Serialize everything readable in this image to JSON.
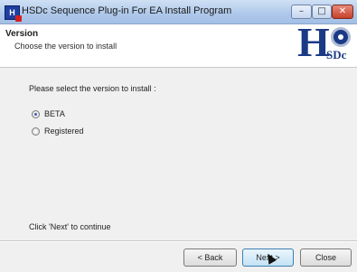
{
  "window": {
    "title": "HSDc Sequence Plug-in For EA Install Program",
    "app_icon_text": "H",
    "controls": {
      "minimize": "–",
      "maximize": "□",
      "close": "✕"
    }
  },
  "header": {
    "title": "Version",
    "subtitle": "Choose the version to install",
    "logo": {
      "letter": "H",
      "text": "SDc"
    }
  },
  "body": {
    "prompt": "Please select the version to install :",
    "options": [
      {
        "label": "BETA",
        "checked": true
      },
      {
        "label": "Registered",
        "checked": false
      }
    ],
    "footer_note": "Click 'Next' to continue"
  },
  "buttons": {
    "back": "< Back",
    "next": "Next >",
    "close": "Close"
  },
  "colors": {
    "brand": "#1b3a86",
    "close_red": "#c6412a"
  }
}
